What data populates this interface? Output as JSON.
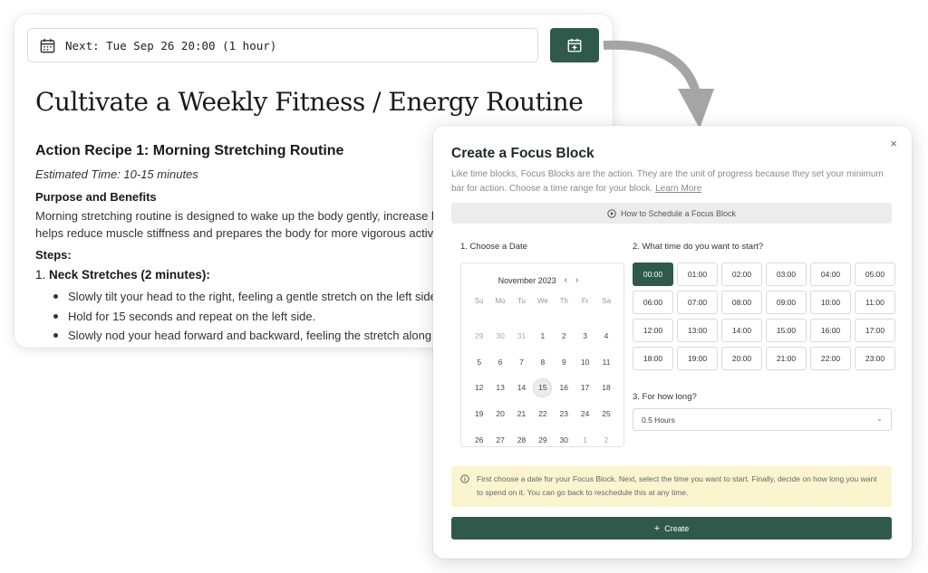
{
  "doc": {
    "next_label": "Next: Tue Sep 26 20:00 (1 hour)",
    "title": "Cultivate a Weekly Fitness / Energy Routine",
    "recipe_title": "Action Recipe 1: Morning Stretching Routine",
    "estimated_time": "Estimated Time: 10-15 minutes",
    "purpose_heading": "Purpose and Benefits",
    "purpose_line_1": "Morning stretching routine is designed to wake up the body gently, increase blood",
    "purpose_line_2": "helps reduce muscle stiffness and prepares the body for more vigorous activities",
    "steps_heading": "Steps:",
    "step_number": "1.",
    "step_1_title": "Neck Stretches (2 minutes):",
    "bullets": [
      "Slowly tilt your head to the right, feeling a gentle stretch on the left side of",
      "Hold for 15 seconds and repeat on the left side.",
      "Slowly nod your head forward and backward, feeling the stretch along the b"
    ]
  },
  "modal": {
    "title": "Create a Focus Block",
    "close": "×",
    "description": "Like time blocks, Focus Blocks are the action. They are the unit of progress because they set your minimum bar for action. Choose a time range for your block.",
    "learn_more": "Learn More",
    "how_to": "How to Schedule a Focus Block",
    "section_date": "1. Choose a Date",
    "section_time": "2. What time do you want to start?",
    "section_duration": "3. For how long?",
    "calendar": {
      "month": "November 2023",
      "prev": "‹",
      "next": "›",
      "weekdays": [
        "Su",
        "Mo",
        "Tu",
        "We",
        "Th",
        "Fr",
        "Sa"
      ],
      "weeks": [
        [
          "29",
          "30",
          "31",
          "1",
          "2",
          "3",
          "4"
        ],
        [
          "5",
          "6",
          "7",
          "8",
          "9",
          "10",
          "11"
        ],
        [
          "12",
          "13",
          "14",
          "15",
          "16",
          "17",
          "18"
        ],
        [
          "19",
          "20",
          "21",
          "22",
          "23",
          "24",
          "25"
        ],
        [
          "26",
          "27",
          "28",
          "29",
          "30",
          "1",
          "2"
        ]
      ],
      "highlighted_day": "15"
    },
    "times": [
      "00:00",
      "01:00",
      "02:00",
      "03:00",
      "04:00",
      "05:00",
      "06:00",
      "07:00",
      "08:00",
      "09:00",
      "10:00",
      "11:00",
      "12:00",
      "13:00",
      "14:00",
      "15:00",
      "16:00",
      "17:00",
      "18:00",
      "19:00",
      "20:00",
      "21:00",
      "22:00",
      "23:00"
    ],
    "selected_time": "00:00",
    "duration": "0.5 Hours",
    "info": "First choose a date for your Focus Block. Next, select the time you want to start. Finally, decide on how long you want to spend on it. You can go back to reschedule this at any time.",
    "create_label": "Create"
  },
  "colors": {
    "accent": "#2f5a4a",
    "info_bg": "#faf5cf"
  }
}
